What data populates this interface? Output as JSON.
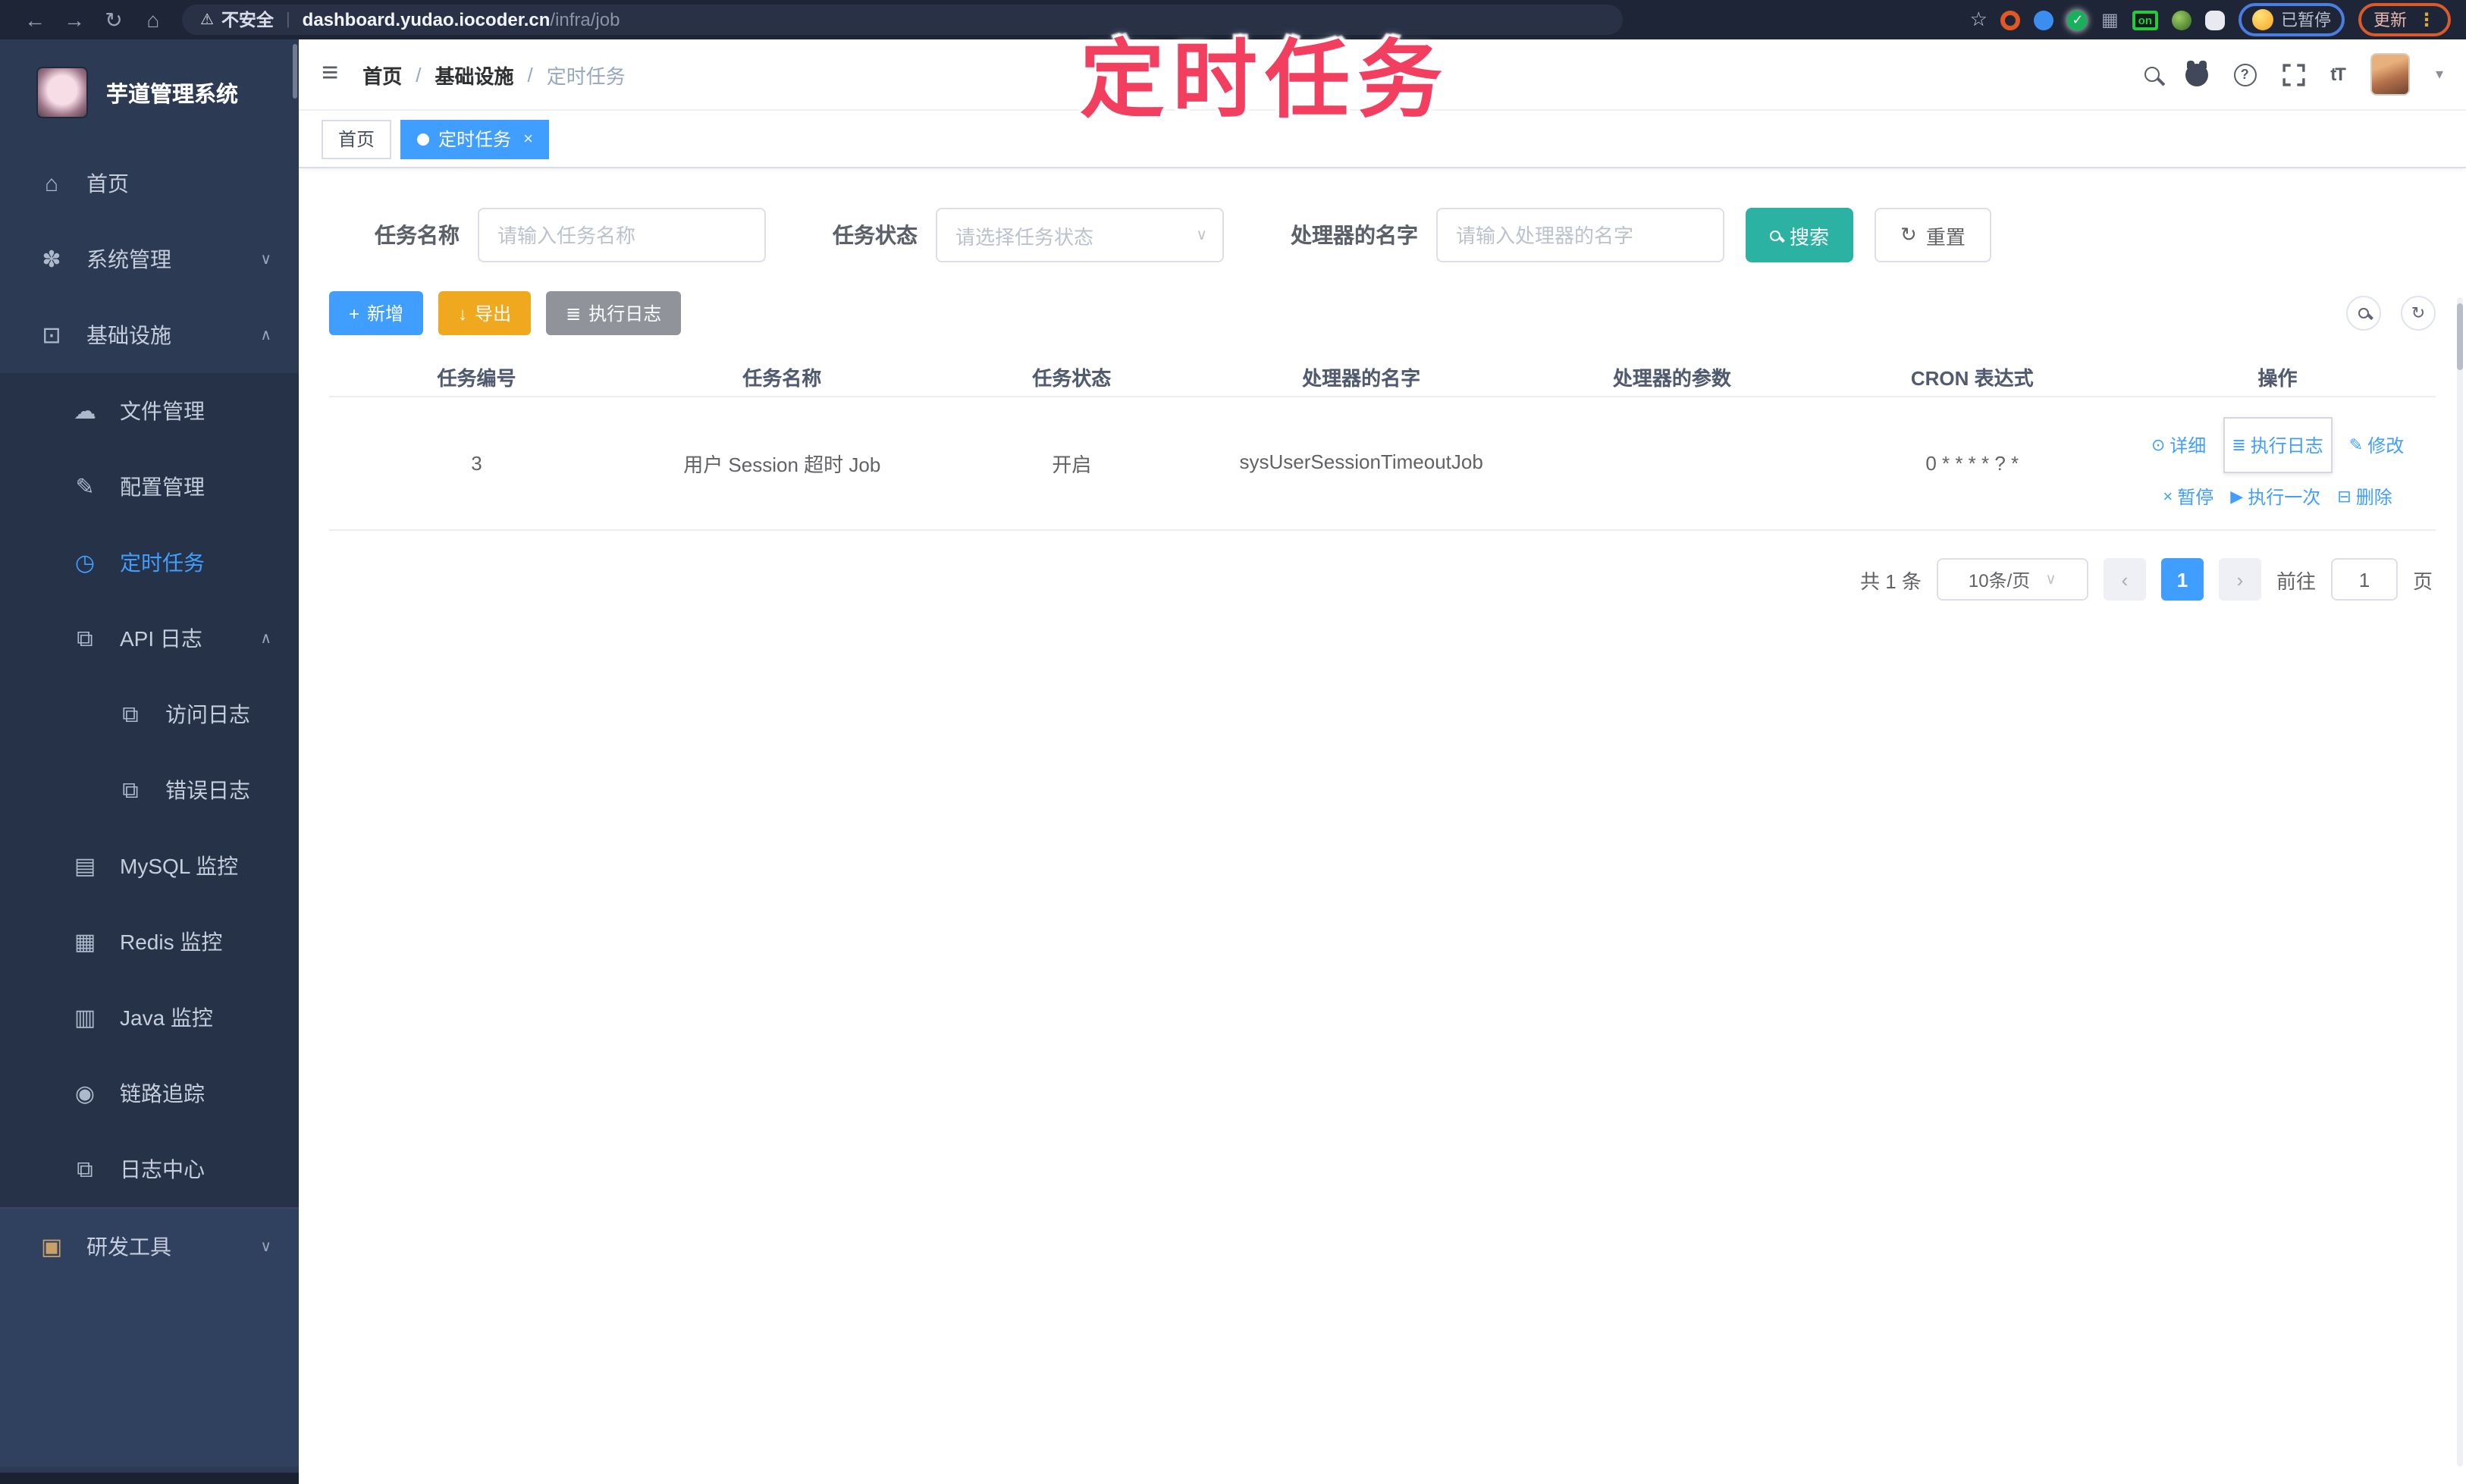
{
  "colors": {
    "accent": "#409eff",
    "search_button": "#2bb2a3",
    "export_button": "#f0a91f",
    "info_button": "#909399",
    "annotation_pink": "#f23f5f",
    "sidebar_bg": "#2d3a53",
    "browser_bar_bg": "#1d2536"
  },
  "browser": {
    "back_glyph": "←",
    "forward_glyph": "→",
    "reload_glyph": "↻",
    "home_glyph": "⌂",
    "warning_glyph": "⚠",
    "security_label": "不安全",
    "url_host": "dashboard.yudao.iocoder.cn",
    "url_path": "/infra/job",
    "star_glyph": "☆",
    "grid_glyph": "▦",
    "check_glyph": "✓",
    "on_badge": "on",
    "paused_chip": "已暂停",
    "update_chip": "更新",
    "kebab_glyph": "⋮"
  },
  "annotation": {
    "watermark": "定时任务"
  },
  "sidebar": {
    "app_title": "芋道管理系统",
    "items": [
      {
        "label": "首页",
        "glyph": "⌂"
      },
      {
        "label": "系统管理",
        "glyph": "✽",
        "chevron": "∨"
      },
      {
        "label": "基础设施",
        "glyph": "⊡",
        "chevron": "∧"
      },
      {
        "label": "文件管理",
        "glyph": "☁"
      },
      {
        "label": "配置管理",
        "glyph": "✎"
      },
      {
        "label": "定时任务",
        "glyph": "◷"
      },
      {
        "label": "API 日志",
        "glyph": "⧉",
        "chevron": "∧"
      },
      {
        "label": "访问日志",
        "glyph": "⧉"
      },
      {
        "label": "错误日志",
        "glyph": "⧉"
      },
      {
        "label": "MySQL 监控",
        "glyph": "▤"
      },
      {
        "label": "Redis 监控",
        "glyph": "▦"
      },
      {
        "label": "Java 监控",
        "glyph": "▥"
      },
      {
        "label": "链路追踪",
        "glyph": "◉"
      },
      {
        "label": "日志中心",
        "glyph": "⧉"
      },
      {
        "label": "研发工具",
        "glyph": "▣",
        "chevron": "∨"
      }
    ]
  },
  "header": {
    "hamburger_glyph": "≡",
    "breadcrumb": [
      {
        "label": "首页"
      },
      {
        "label": "基础设施"
      },
      {
        "label": "定时任务"
      }
    ],
    "separator": "/",
    "help_glyph": "?",
    "font_size_glyph": "tT",
    "caret_glyph": "▾"
  },
  "tabs": [
    {
      "label": "首页"
    },
    {
      "label": "定时任务",
      "close": "×"
    }
  ],
  "filters": {
    "name_label": "任务名称",
    "name_placeholder": "请输入任务名称",
    "status_label": "任务状态",
    "status_placeholder": "请选择任务状态",
    "status_caret": "∨",
    "handler_label": "处理器的名字",
    "handler_placeholder": "请输入处理器的名字",
    "search_label": "搜索",
    "reset_label": "重置",
    "reset_glyph": "↻"
  },
  "toolbar": {
    "add_glyph": "+",
    "add_label": "新增",
    "export_glyph": "↓",
    "export_label": "导出",
    "log_glyph": "≣",
    "log_label": "执行日志",
    "refresh_glyph": "↻"
  },
  "table": {
    "columns": [
      "任务编号",
      "任务名称",
      "任务状态",
      "处理器的名字",
      "处理器的参数",
      "CRON 表达式",
      "操作"
    ],
    "row": {
      "id": "3",
      "name": "用户 Session 超时 Job",
      "status": "开启",
      "handler": "sysUserSessionTimeoutJob",
      "param": "",
      "cron": "0 * * * * ? *"
    },
    "actions": [
      {
        "glyph": "⊙",
        "label": "详细"
      },
      {
        "glyph": "≣",
        "label": "执行日志"
      },
      {
        "glyph": "✎",
        "label": "修改"
      },
      {
        "glyph": "×",
        "label": "暂停"
      },
      {
        "glyph": "▶",
        "label": "执行一次"
      },
      {
        "glyph": "⊟",
        "label": "删除"
      }
    ]
  },
  "pagination": {
    "total": "共 1 条",
    "page_size": "10条/页",
    "size_caret": "∨",
    "prev_glyph": "‹",
    "page": "1",
    "next_glyph": "›",
    "goto_label": "前往",
    "goto_value": "1",
    "unit_label": "页"
  }
}
